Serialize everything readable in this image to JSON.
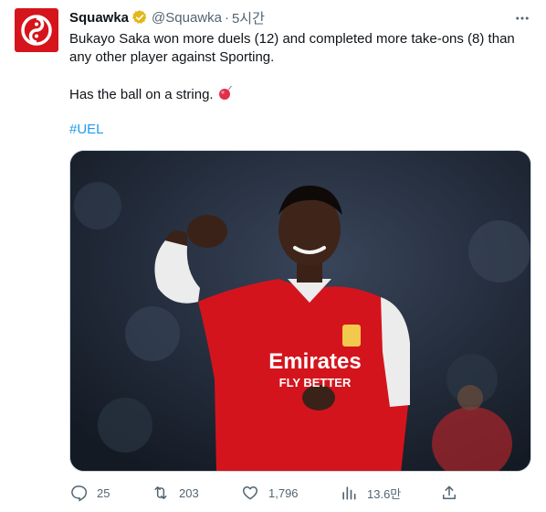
{
  "author": {
    "display_name": "Squawka",
    "handle": "@Squawka",
    "time": "5시간",
    "separator": "·",
    "verified_color": "#e2b719"
  },
  "tweet": {
    "line1": "Bukayo Saka won more duels (12) and completed more take-ons (8) than",
    "line2": "any other player against Sporting.",
    "line3": "Has the ball on a string.",
    "hashtag": "#UEL"
  },
  "media": {
    "kit_text_1": "Emirates",
    "kit_text_2": "FLY BETTER"
  },
  "actions": {
    "replies": "25",
    "retweets": "203",
    "likes": "1,796",
    "views": "13.6만"
  },
  "colors": {
    "brand": "#d5141c",
    "link": "#1d9bf0",
    "muted": "#536471"
  },
  "icons": [
    "squawka-logo-icon",
    "verified-badge-icon",
    "more-icon",
    "ball-emoji-icon",
    "reply-icon",
    "retweet-icon",
    "like-icon",
    "views-icon",
    "share-icon"
  ]
}
